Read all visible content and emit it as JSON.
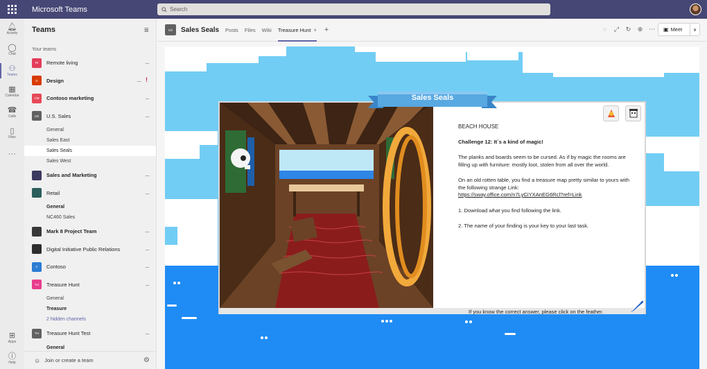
{
  "app": {
    "title": "Microsoft Teams"
  },
  "search": {
    "placeholder": "Search"
  },
  "rail": {
    "items": [
      {
        "label": "Activity",
        "icon": "bell-icon"
      },
      {
        "label": "Chat",
        "icon": "chat-icon"
      },
      {
        "label": "Teams",
        "icon": "teams-icon",
        "active": true
      },
      {
        "label": "Calendar",
        "icon": "calendar-icon"
      },
      {
        "label": "Calls",
        "icon": "phone-icon"
      },
      {
        "label": "Files",
        "icon": "file-icon"
      }
    ],
    "more": "···",
    "apps": "Apps",
    "help": "Help"
  },
  "panel": {
    "title": "Teams",
    "section": "Your teams",
    "footer": "Join or create a team"
  },
  "teams": [
    {
      "abbr": "RI",
      "name": "Remote living",
      "color": "#e33e5a",
      "bold": false,
      "channels": []
    },
    {
      "abbr": "D",
      "name": "Design",
      "color": "#d83b01",
      "bold": true,
      "alert": "!",
      "channels": []
    },
    {
      "abbr": "CM",
      "name": "Contoso marketing",
      "color": "#e74856",
      "bold": true,
      "channels": []
    },
    {
      "abbr": "US",
      "name": "U.S. Sales",
      "color": "#616161",
      "bold": false,
      "channels": [
        {
          "name": "General"
        },
        {
          "name": "Sales East"
        },
        {
          "name": "Sales Seals",
          "active": true
        },
        {
          "name": "Sales West"
        }
      ]
    },
    {
      "abbr": "",
      "name": "Sales and Marketing",
      "color": "#3b3a5e",
      "bold": true,
      "channels": []
    },
    {
      "abbr": "",
      "name": "Retail",
      "color": "#2b5e5b",
      "bold": false,
      "channels": [
        {
          "name": "General",
          "bold": true
        },
        {
          "name": "NC460 Sales"
        }
      ]
    },
    {
      "abbr": "",
      "name": "Mark 8 Project Team",
      "color": "#383838",
      "bold": true,
      "channels": []
    },
    {
      "abbr": "",
      "name": "Digital Initiative Public Relations",
      "color": "#2d2d2d",
      "bold": false,
      "channels": []
    },
    {
      "abbr": "C",
      "name": "Contoso",
      "color": "#2b7cd3",
      "bold": false,
      "channels": []
    },
    {
      "abbr": "TH",
      "name": "Treasure Hunt",
      "color": "#e83e8c",
      "bold": false,
      "channels": [
        {
          "name": "General"
        },
        {
          "name": "Treasure",
          "bold": true
        },
        {
          "name": "2 hidden channels",
          "link": true
        }
      ]
    },
    {
      "abbr": "TH",
      "name": "Treasure Hunt Test",
      "color": "#616161",
      "bold": false,
      "channels": [
        {
          "name": "General",
          "bold": true
        }
      ]
    }
  ],
  "header": {
    "avatar": "US",
    "title": "Sales Seals",
    "tabs": [
      "Posts",
      "Files",
      "Wiki",
      "Treasure Hunt"
    ],
    "active_tab": "Treasure Hunt",
    "meet": "Meet"
  },
  "card": {
    "banner": "Sales Seals",
    "heading": "BEACH HOUSE",
    "challenge": "Challenge 12: It´s a kind of magic!",
    "para1": "The planks and boards seem to be cursed. As if by magic the rooms are filling up with furniture: mostly loot, stolen from all over the world.",
    "para2_text": "On an old rotten table, you find a treasure map pretty similar to yours with the following strange Link:",
    "para2_link": "https://sway.office.com/n7LyCiYXAnEG6Rcl?ref=Link",
    "step1": "1. Download what you find following the link.",
    "step2": "2. The name of your finding is your key to your last task.",
    "footer": "If you know the correct answer, please click on the feather."
  }
}
